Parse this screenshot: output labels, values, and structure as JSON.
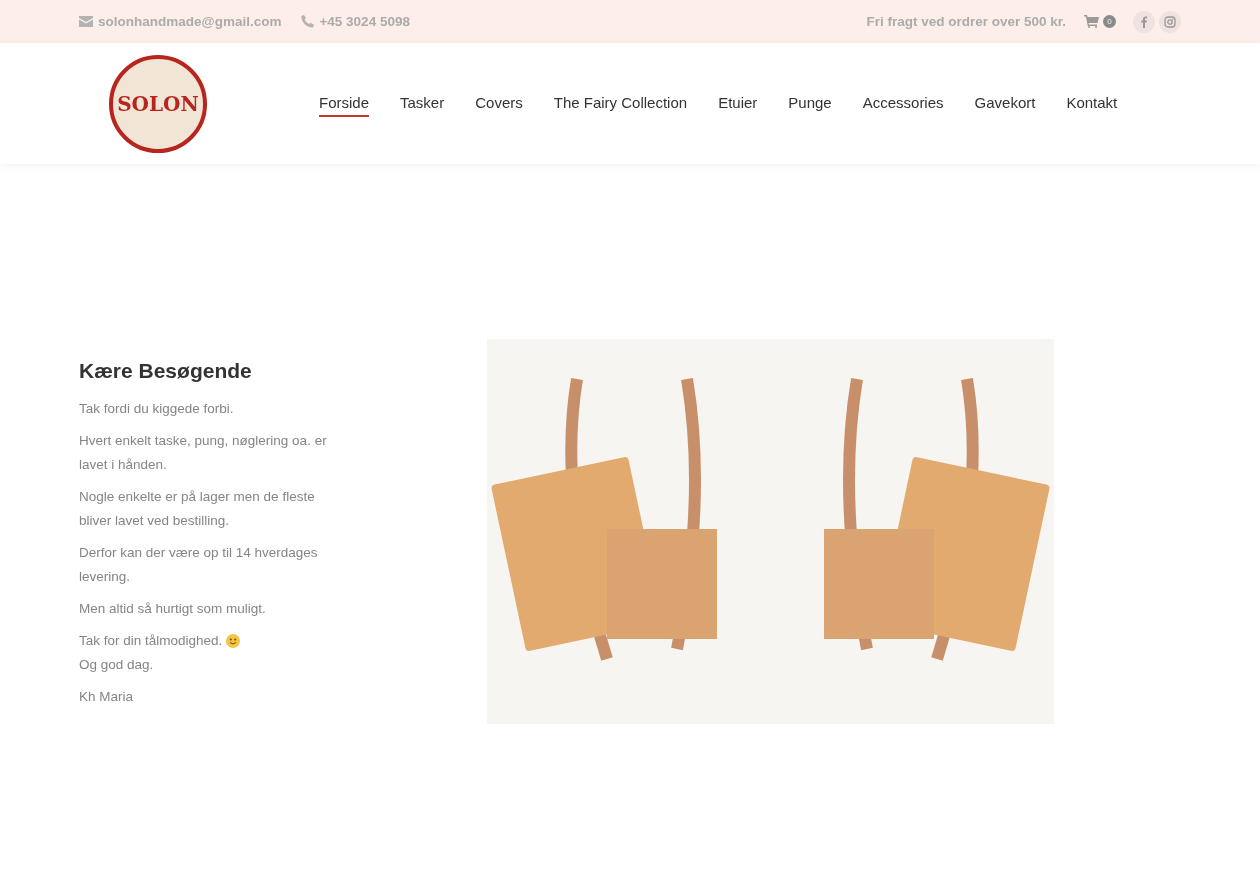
{
  "topbar": {
    "email": "solonhandmade@gmail.com",
    "phone": "+45 3024 5098",
    "shipping_note": "Fri fragt ved ordrer over 500 kr.",
    "cart_count": "0"
  },
  "logo": {
    "text": "SOLON"
  },
  "nav": [
    {
      "label": "Forside",
      "selected": true
    },
    {
      "label": "Tasker",
      "selected": false
    },
    {
      "label": "Covers",
      "selected": false
    },
    {
      "label": "The Fairy Collection",
      "selected": false
    },
    {
      "label": "Etuier",
      "selected": false
    },
    {
      "label": "Punge",
      "selected": false
    },
    {
      "label": "Accessories",
      "selected": false
    },
    {
      "label": "Gavekort",
      "selected": false
    },
    {
      "label": "Kontakt",
      "selected": false
    }
  ],
  "content": {
    "heading": "Kære Besøgende",
    "paragraphs": [
      {
        "lines": [
          {
            "text": "Tak fordi du kiggede forbi."
          }
        ]
      },
      {
        "lines": [
          {
            "text": "Hvert enkelt taske, pung, nøglering oa. er lavet i hånden."
          }
        ]
      },
      {
        "lines": [
          {
            "text": "Nogle enkelte er på lager men de fleste bliver lavet ved bestilling."
          }
        ]
      },
      {
        "lines": [
          {
            "text": "Derfor kan der være op til 14 hverdages levering."
          }
        ]
      },
      {
        "lines": [
          {
            "text": "Men altid så hurtigt som muligt."
          }
        ]
      },
      {
        "lines": [
          {
            "text": "Tak for din tålmodighed.",
            "smiley": true
          },
          {
            "text": "Og god dag."
          }
        ]
      },
      {
        "lines": [
          {
            "text": "Kh Maria"
          }
        ]
      }
    ]
  }
}
